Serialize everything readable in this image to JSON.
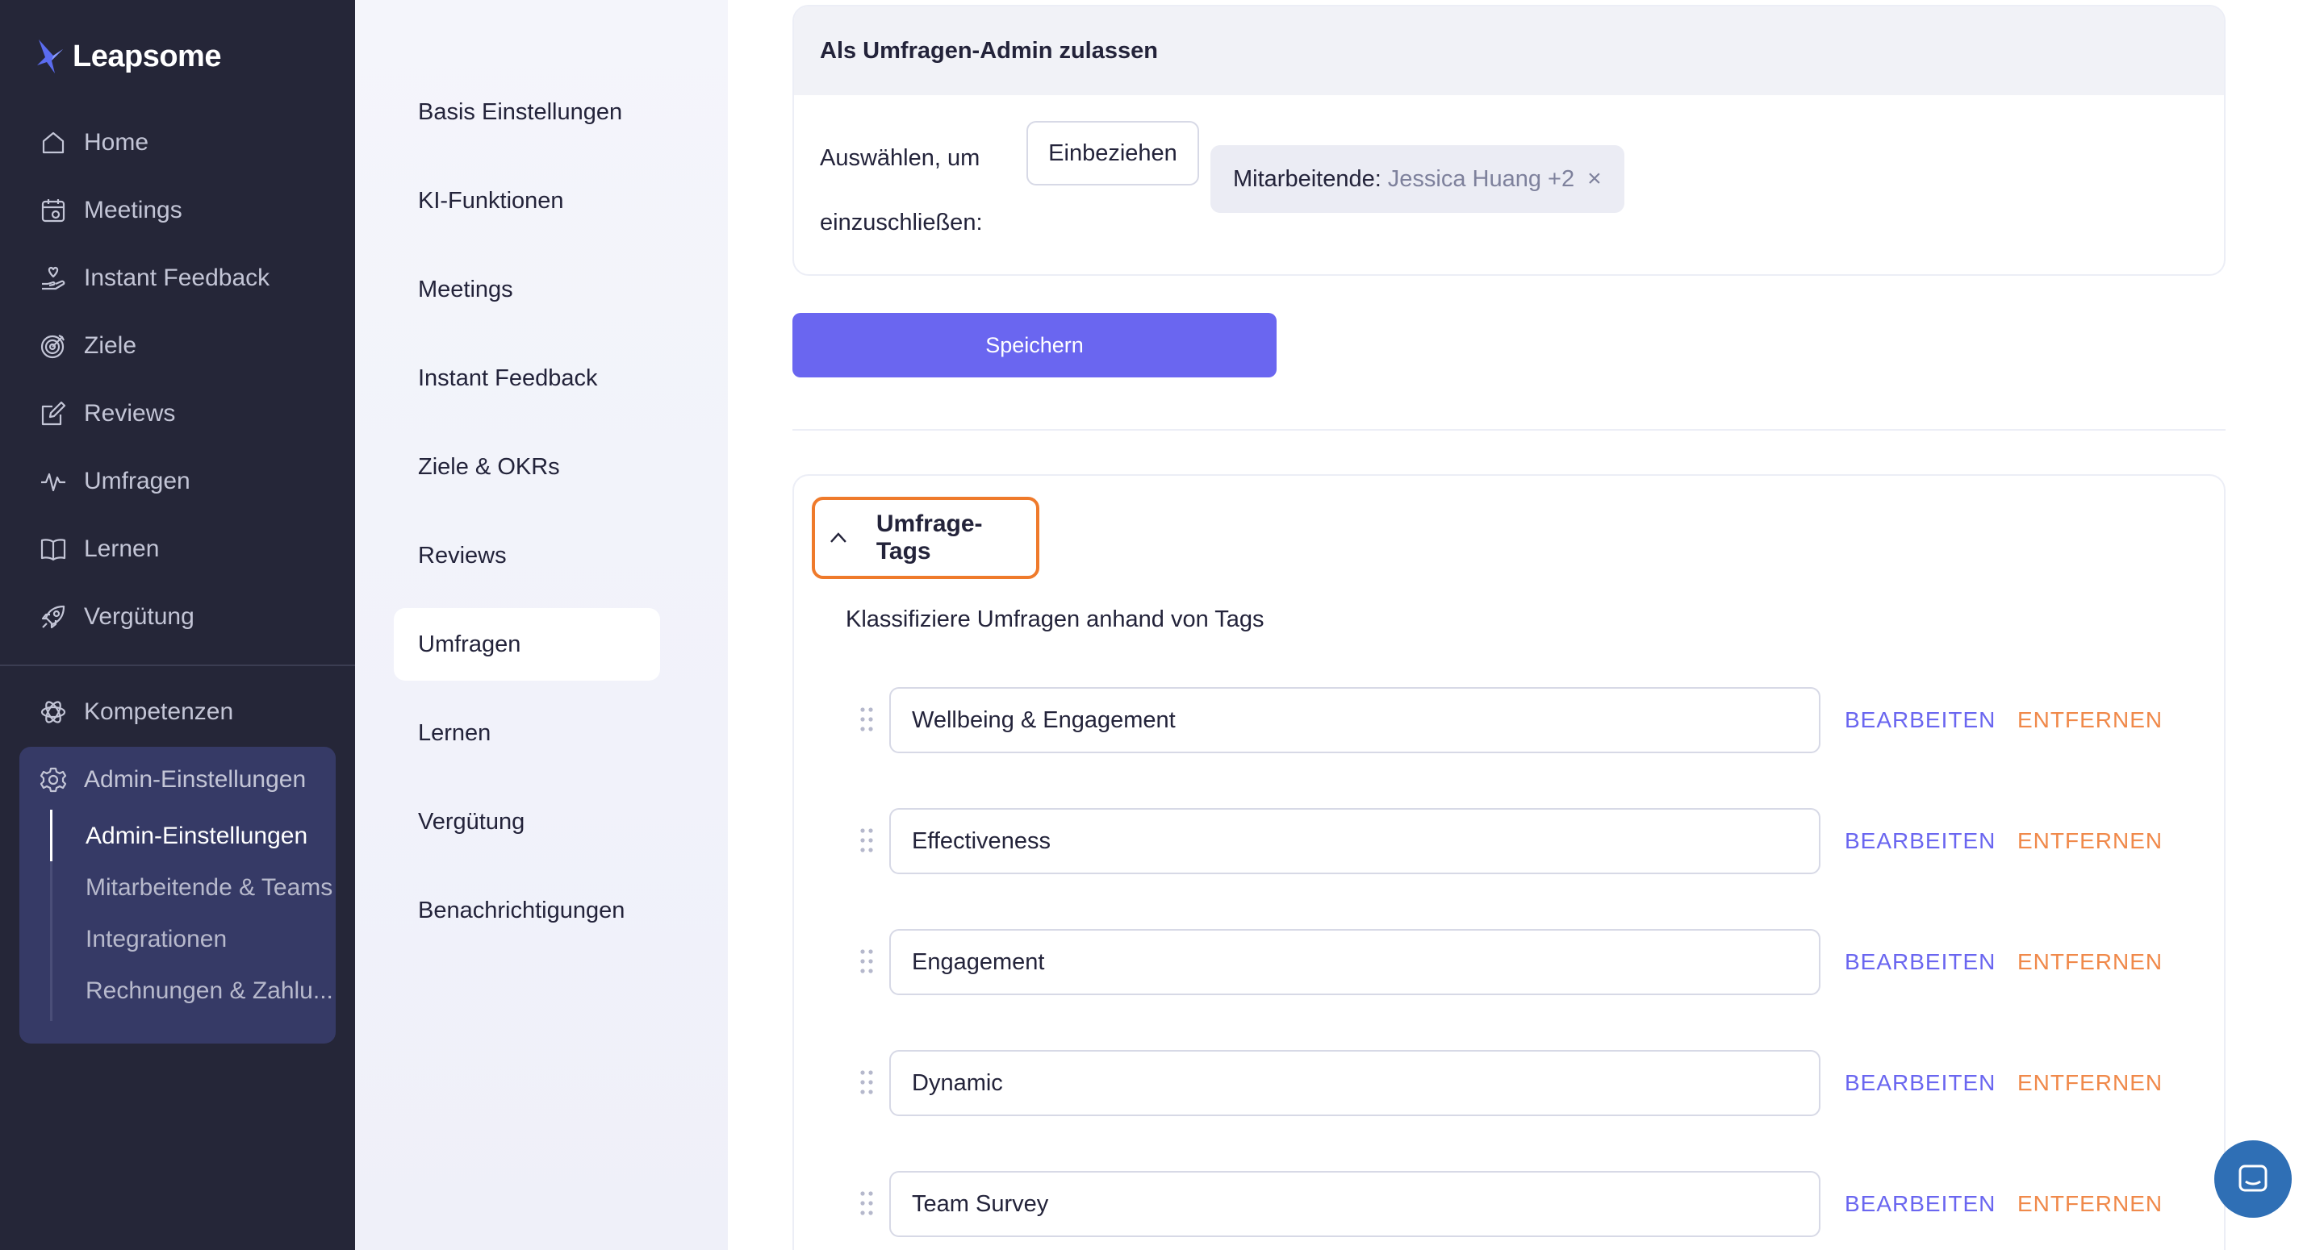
{
  "brand": {
    "name": "Leapsome"
  },
  "sidebar": {
    "items": [
      {
        "label": "Home",
        "icon": "home-icon"
      },
      {
        "label": "Meetings",
        "icon": "calendar-icon"
      },
      {
        "label": "Instant Feedback",
        "icon": "hand-heart-icon"
      },
      {
        "label": "Ziele",
        "icon": "target-icon"
      },
      {
        "label": "Reviews",
        "icon": "edit-icon"
      },
      {
        "label": "Umfragen",
        "icon": "pulse-icon"
      },
      {
        "label": "Lernen",
        "icon": "book-icon"
      },
      {
        "label": "Vergütung",
        "icon": "rocket-icon"
      }
    ],
    "lower_items": [
      {
        "label": "Kompetenzen",
        "icon": "atom-icon"
      },
      {
        "label": "Admin-Einstellungen",
        "icon": "gear-icon"
      }
    ],
    "admin_sub": [
      {
        "label": "Admin-Einstellungen",
        "active": true
      },
      {
        "label": "Mitarbeitende & Teams",
        "active": false
      },
      {
        "label": "Integrationen",
        "active": false
      },
      {
        "label": "Rechnungen & Zahlu...",
        "active": false
      }
    ]
  },
  "settings_nav": [
    {
      "label": "Basis Einstellungen"
    },
    {
      "label": "KI-Funktionen"
    },
    {
      "label": "Meetings"
    },
    {
      "label": "Instant Feedback"
    },
    {
      "label": "Ziele & OKRs"
    },
    {
      "label": "Reviews"
    },
    {
      "label": "Umfragen",
      "active": true
    },
    {
      "label": "Lernen"
    },
    {
      "label": "Vergütung"
    },
    {
      "label": "Benachrichtigungen"
    }
  ],
  "admin_card": {
    "title": "Als Umfragen-Admin zulassen",
    "select_label": "Auswählen, um einzuschließen:",
    "include_button": "Einbeziehen",
    "chip_label": "Mitarbeitende:",
    "chip_value": "Jessica Huang +2",
    "chip_remove": "×"
  },
  "save_button": "Speichern",
  "tags_section": {
    "title": "Umfrage-Tags",
    "description": "Klassifiziere Umfragen anhand von Tags",
    "edit_label": "BEARBEITEN",
    "remove_label": "ENTFERNEN",
    "tags": [
      {
        "value": "Wellbeing & Engagement"
      },
      {
        "value": "Effectiveness"
      },
      {
        "value": "Engagement"
      },
      {
        "value": "Dynamic"
      },
      {
        "value": "Team Survey"
      }
    ]
  },
  "colors": {
    "sidebar_bg": "#252638",
    "accent": "#6a66f0",
    "remove": "#f0894a",
    "highlight": "#ef7a2b",
    "chat": "#2f6fb5"
  }
}
